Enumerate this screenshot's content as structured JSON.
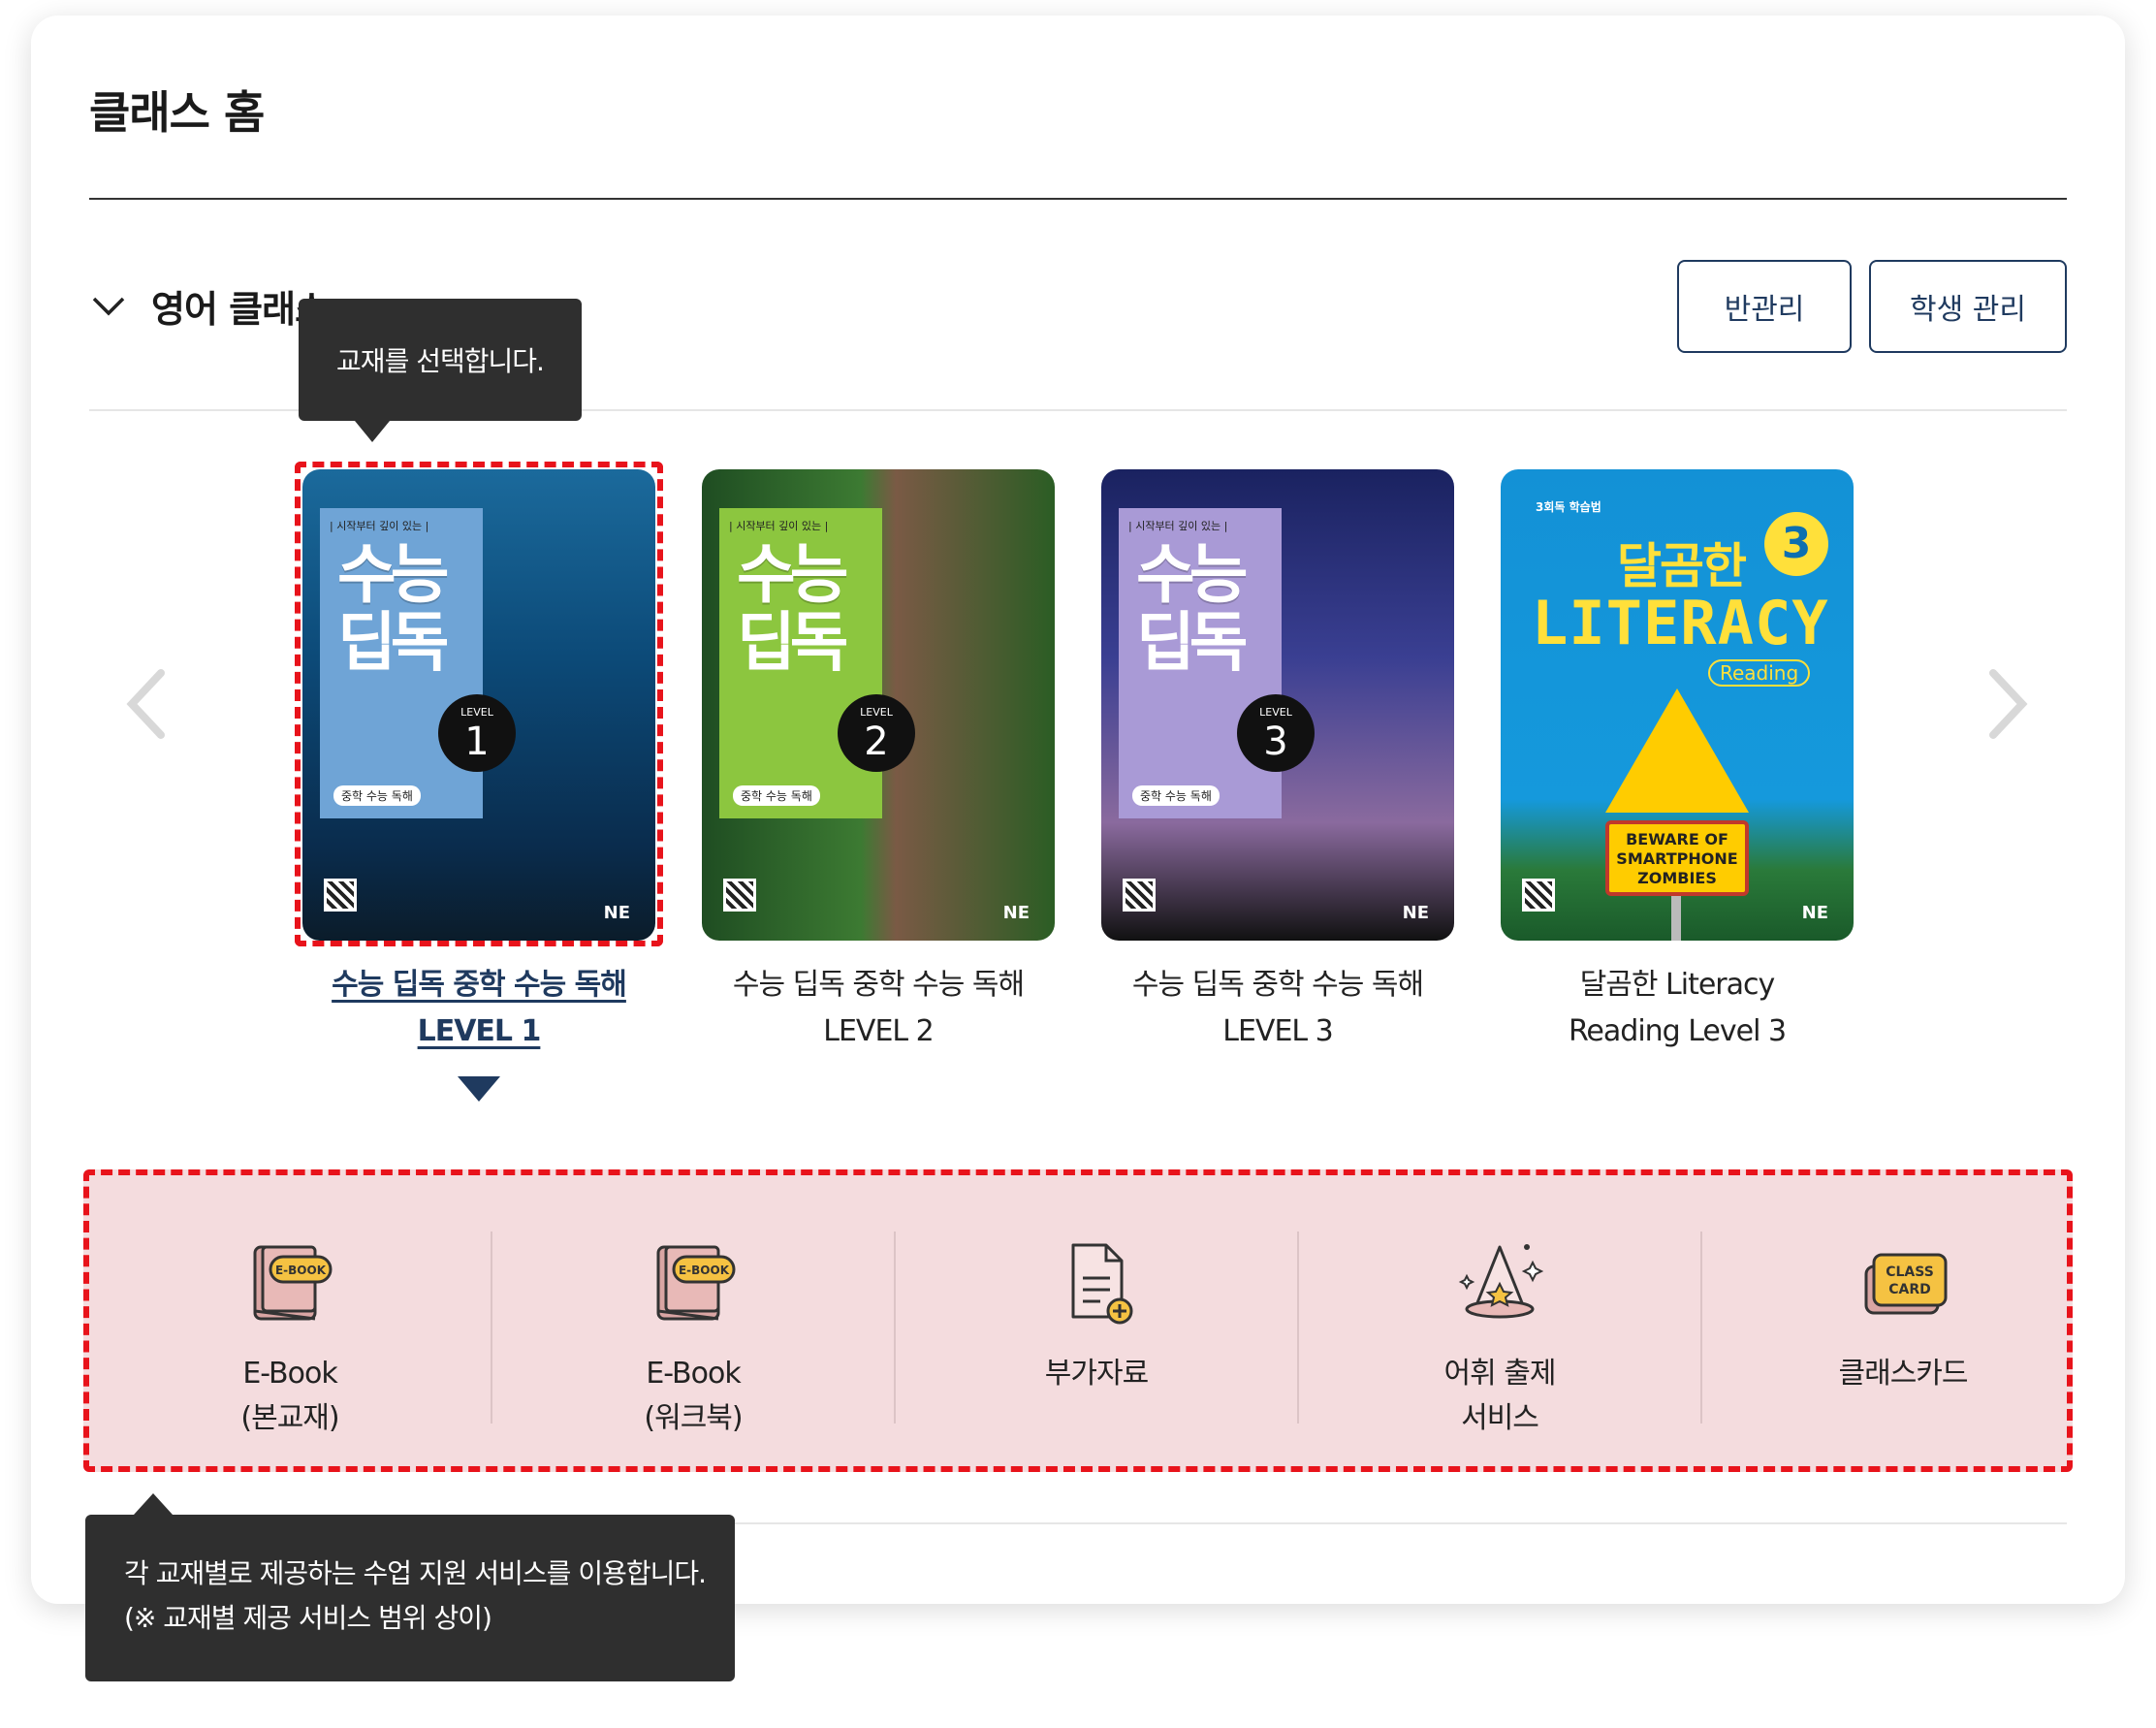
{
  "header": {
    "title": "클래스 홈"
  },
  "class_section": {
    "name": "영어 클래스",
    "buttons": {
      "class_manage": "반관리",
      "student_manage": "학생 관리"
    }
  },
  "books": [
    {
      "title_line1": "수능 딥독 중학 수능 독해",
      "title_line2": "LEVEL 1",
      "selected": true,
      "cover": {
        "top_text": "| 시작부터 깊이 있는 |",
        "big1": "수능",
        "big2": "딥독",
        "level_label": "LEVEL",
        "level": "1",
        "tag": "중학 수능 독해",
        "publisher": "NE"
      }
    },
    {
      "title_line1": "수능 딥독 중학 수능 독해",
      "title_line2": "LEVEL 2",
      "selected": false,
      "cover": {
        "top_text": "| 시작부터 깊이 있는 |",
        "big1": "수능",
        "big2": "딥독",
        "level_label": "LEVEL",
        "level": "2",
        "tag": "중학 수능 독해",
        "publisher": "NE"
      }
    },
    {
      "title_line1": "수능 딥독 중학 수능 독해",
      "title_line2": "LEVEL 3",
      "selected": false,
      "cover": {
        "top_text": "| 시작부터 깊이 있는 |",
        "big1": "수능",
        "big2": "딥독",
        "level_label": "LEVEL",
        "level": "3",
        "tag": "중학 수능 독해",
        "publisher": "NE"
      }
    },
    {
      "title_line1": "달곰한 Literacy",
      "title_line2": "Reading Level 3",
      "selected": false,
      "cover": {
        "top_text": "3회독 학습법",
        "big1": "달곰한",
        "level": "3",
        "word": "LITERACY",
        "sub": "Reading",
        "warn1": "BEWARE OF",
        "warn2": "SMARTPHONE",
        "warn3": "ZOMBIES",
        "publisher": "NE"
      }
    }
  ],
  "services": [
    {
      "label1": "E-Book",
      "label2": "(본교재)",
      "icon": "ebook-icon",
      "badge": "E-BOOK"
    },
    {
      "label1": "E-Book",
      "label2": "(워크북)",
      "icon": "ebook-icon",
      "badge": "E-BOOK"
    },
    {
      "label1": "부가자료",
      "label2": "",
      "icon": "document-add-icon"
    },
    {
      "label1": "어휘 출제",
      "label2": "서비스",
      "icon": "wizard-hat-icon"
    },
    {
      "label1": "클래스카드",
      "label2": "",
      "icon": "class-card-icon",
      "badge1": "CLASS",
      "badge2": "CARD"
    }
  ],
  "tooltips": {
    "book_select": "교재를 선택합니다.",
    "services_line1": "각 교재별로 제공하는 수업 지원 서비스를 이용합니다.",
    "services_line2": "(※ 교재별 제공 서비스 범위 상이)"
  },
  "colors": {
    "accent_navy": "#1f3a5f",
    "highlight_red": "#e8131b",
    "services_bg": "#f4dcde",
    "tooltip_bg": "#2f2f2f"
  }
}
